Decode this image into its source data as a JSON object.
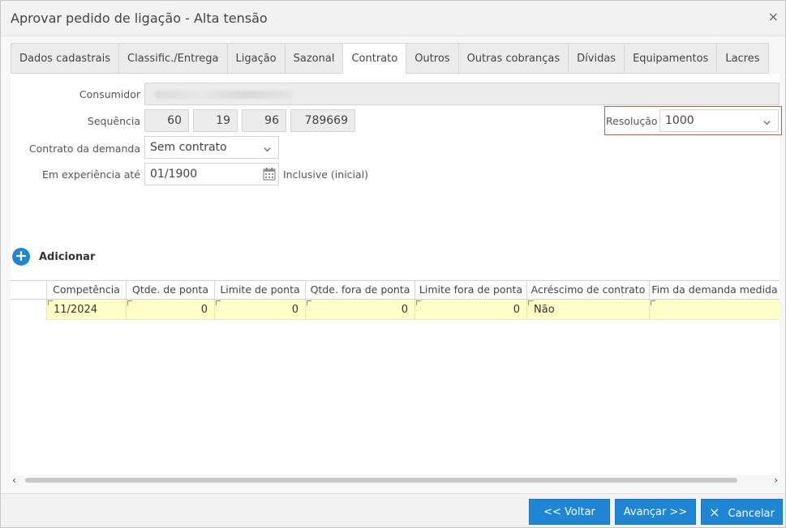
{
  "window": {
    "title": "Aprovar pedido de ligação - Alta tensão",
    "close": "×"
  },
  "tabs": [
    {
      "label": "Dados cadastrais"
    },
    {
      "label": "Classific./Entrega"
    },
    {
      "label": "Ligação"
    },
    {
      "label": "Sazonal"
    },
    {
      "label": "Contrato",
      "active": true
    },
    {
      "label": "Outros"
    },
    {
      "label": "Outras cobranças"
    },
    {
      "label": "Dívidas"
    },
    {
      "label": "Equipamentos"
    },
    {
      "label": "Lacres"
    }
  ],
  "form": {
    "consumidor_label": "Consumidor",
    "sequencia_label": "Sequência",
    "sequencia": [
      "60",
      "19",
      "96",
      "789669"
    ],
    "resolucao_label": "Resolução",
    "resolucao_value": "1000",
    "contrato_label": "Contrato da demanda",
    "contrato_value": "Sem contrato",
    "experiencia_label": "Em experiência até",
    "experiencia_value": "01/1900",
    "experiencia_suffix": "Inclusive (inicial)"
  },
  "grid": {
    "add_label": "Adicionar",
    "columns": [
      "Competência",
      "Qtde. de ponta",
      "Limite de ponta",
      "Qtde. fora de ponta",
      "Limite fora de ponta",
      "Acréscimo de contrato",
      "Fim da demanda medida"
    ],
    "rows": [
      [
        "11/2024",
        "0",
        "0",
        "0",
        "0",
        "Não",
        ""
      ]
    ]
  },
  "scroll": {
    "left": "‹",
    "right": "›"
  },
  "footer": {
    "back": "<< Voltar",
    "next": "Avançar >>",
    "cancel": "Cancelar",
    "cancel_icon": "×"
  },
  "colors": {
    "accent": "#1f86d6",
    "row_highlight": "#ffffc6",
    "resolution_border": "#d9534f"
  }
}
